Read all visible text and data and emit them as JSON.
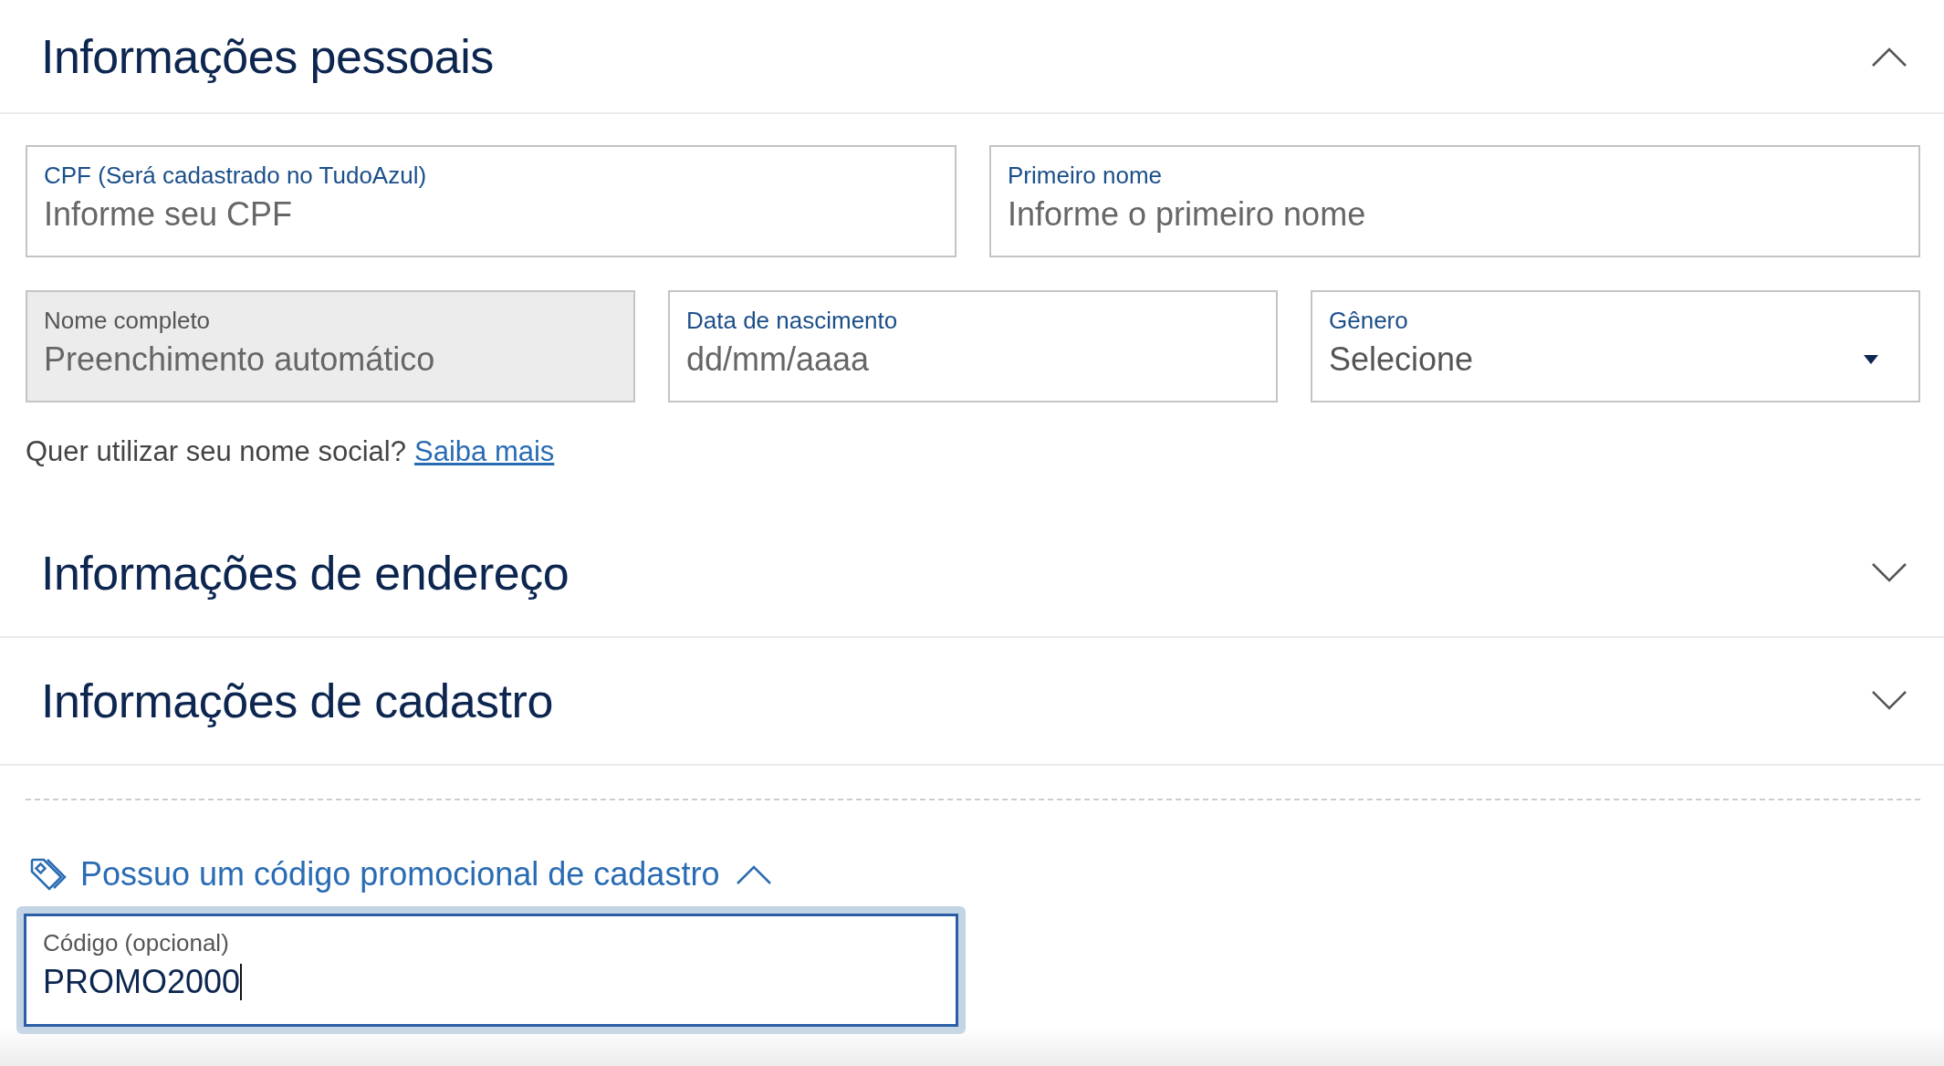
{
  "sections": [
    {
      "title": "Informações pessoais",
      "expanded": true,
      "rows": [
        [
          {
            "kind": "text",
            "label": "CPF (Será cadastrado no TudoAzul)",
            "placeholder": "Informe seu CPF",
            "disabled": false
          },
          {
            "kind": "text",
            "label": "Primeiro nome",
            "placeholder": "Informe o primeiro nome",
            "disabled": false
          }
        ],
        [
          {
            "kind": "text",
            "label": "Nome completo",
            "placeholder": "Preenchimento automático",
            "disabled": true
          },
          {
            "kind": "text",
            "label": "Data de nascimento",
            "placeholder": "dd/mm/aaaa",
            "disabled": false
          },
          {
            "kind": "select",
            "label": "Gênero",
            "placeholder": "Selecione",
            "disabled": false
          }
        ]
      ],
      "note": {
        "text": "Quer utilizar seu nome social?",
        "link": "Saiba mais"
      }
    },
    {
      "title": "Informações de endereço",
      "expanded": false
    },
    {
      "title": "Informações de cadastro",
      "expanded": false
    }
  ],
  "promo": {
    "toggle": "Possuo um código promocional de cadastro",
    "expanded": true,
    "field": {
      "label": "Código (opcional)",
      "value": "PROMO2000",
      "focused": true
    }
  }
}
